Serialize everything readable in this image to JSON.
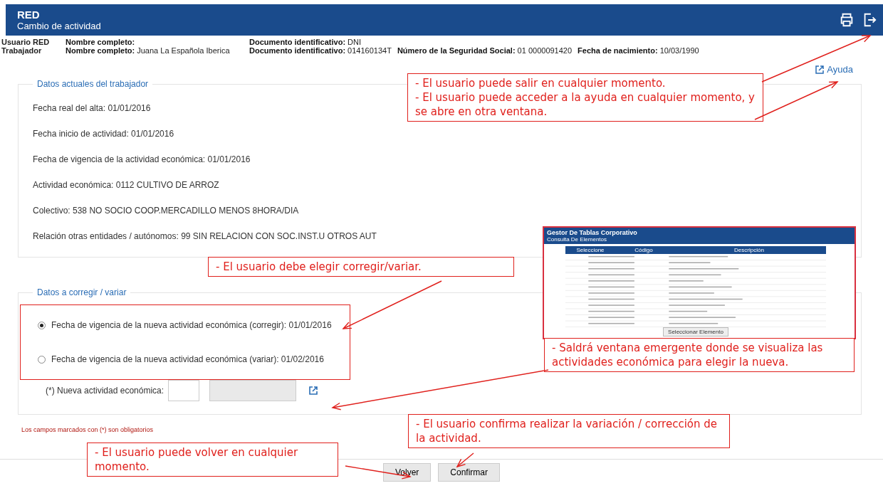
{
  "header": {
    "app": "RED",
    "title": "Cambio de actividad"
  },
  "info_rows": [
    {
      "heading": "Usuario RED",
      "fields": [
        {
          "label": "Nombre completo:"
        },
        {
          "label": "Documento identificativo:",
          "value": "DNI"
        }
      ]
    },
    {
      "heading": "Trabajador",
      "fields": [
        {
          "label": "Nombre completo:",
          "value": "Juana La Española Iberica"
        },
        {
          "label": "Documento identificativo:",
          "value": "014160134T"
        },
        {
          "label": "Número de la Seguridad Social:",
          "value": "01 0000091420"
        },
        {
          "label": "Fecha de nacimiento:",
          "value": "10/03/1990"
        }
      ]
    }
  ],
  "help_link": "Ayuda",
  "current_data": {
    "legend": "Datos actuales del trabajador",
    "items": [
      "Fecha real del alta: 01/01/2016",
      "Fecha inicio de actividad: 01/01/2016",
      "Fecha de vigencia de la actividad económica: 01/01/2016",
      "Actividad económica: 0112 CULTIVO DE ARROZ",
      "Colectivo: 538 NO SOCIO COOP.MERCADILLO MENOS 8HORA/DIA",
      "Relación otras entidades / autónomos: 99 SIN RELACION CON SOC.INST.U OTROS AUT"
    ]
  },
  "change_data": {
    "legend": "Datos a corregir / variar",
    "options": [
      {
        "label": "Fecha de vigencia de la nueva actividad económica (corregir): 01/01/2016",
        "selected": true
      },
      {
        "label": "Fecha de vigencia de la nueva actividad económica (variar): 01/02/2016",
        "selected": false
      }
    ],
    "field_label": "(*) Nueva actividad económica:"
  },
  "required_note": "Los campos marcados con (*) son obligatorios",
  "buttons": [
    "Volver",
    "Confirmar"
  ],
  "popup": {
    "title": "Gestor De Tablas Corporativo",
    "subtitle": "Consulta De Elementos",
    "columns": [
      "Seleccione",
      "Código",
      "Descripción"
    ],
    "action": "Seleccionar Elemento"
  },
  "annotations": [
    {
      "texts": [
        "- El usuario puede salir en cualquier momento.",
        "- El usuario puede acceder a la ayuda en cualquier momento, y se abre en otra ventana."
      ]
    },
    {
      "texts": [
        "- El usuario debe elegir corregir/variar."
      ]
    },
    {
      "texts": [
        "- Saldrá ventana emergente donde se visualiza las actividades económica para elegir la nueva."
      ]
    },
    {
      "texts": [
        "- El usuario confirma realizar la variación / corrección de la actividad."
      ]
    },
    {
      "texts": [
        "- El usuario puede volver en cualquier momento."
      ]
    }
  ]
}
